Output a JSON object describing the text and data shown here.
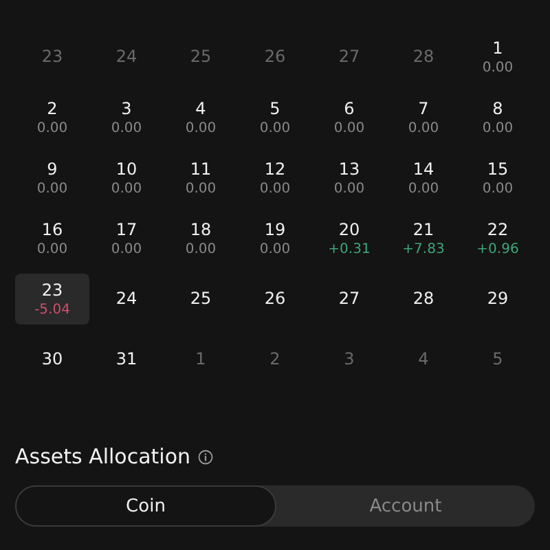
{
  "calendar": {
    "weeks": [
      [
        {
          "day": "23",
          "other_month": true,
          "selected": false
        },
        {
          "day": "24",
          "other_month": true,
          "selected": false
        },
        {
          "day": "25",
          "other_month": true,
          "selected": false
        },
        {
          "day": "26",
          "other_month": true,
          "selected": false
        },
        {
          "day": "27",
          "other_month": true,
          "selected": false
        },
        {
          "day": "28",
          "other_month": true,
          "selected": false
        },
        {
          "day": "1",
          "other_month": false,
          "selected": false,
          "value": "0.00",
          "color": "#8a8a8a"
        }
      ],
      [
        {
          "day": "2",
          "other_month": false,
          "selected": false,
          "value": "0.00",
          "color": "#8a8a8a"
        },
        {
          "day": "3",
          "other_month": false,
          "selected": false,
          "value": "0.00",
          "color": "#8a8a8a"
        },
        {
          "day": "4",
          "other_month": false,
          "selected": false,
          "value": "0.00",
          "color": "#8a8a8a"
        },
        {
          "day": "5",
          "other_month": false,
          "selected": false,
          "value": "0.00",
          "color": "#8a8a8a"
        },
        {
          "day": "6",
          "other_month": false,
          "selected": false,
          "value": "0.00",
          "color": "#8a8a8a"
        },
        {
          "day": "7",
          "other_month": false,
          "selected": false,
          "value": "0.00",
          "color": "#8a8a8a"
        },
        {
          "day": "8",
          "other_month": false,
          "selected": false,
          "value": "0.00",
          "color": "#8a8a8a"
        }
      ],
      [
        {
          "day": "9",
          "other_month": false,
          "selected": false,
          "value": "0.00",
          "color": "#8a8a8a"
        },
        {
          "day": "10",
          "other_month": false,
          "selected": false,
          "value": "0.00",
          "color": "#8a8a8a"
        },
        {
          "day": "11",
          "other_month": false,
          "selected": false,
          "value": "0.00",
          "color": "#8a8a8a"
        },
        {
          "day": "12",
          "other_month": false,
          "selected": false,
          "value": "0.00",
          "color": "#8a8a8a"
        },
        {
          "day": "13",
          "other_month": false,
          "selected": false,
          "value": "0.00",
          "color": "#8a8a8a"
        },
        {
          "day": "14",
          "other_month": false,
          "selected": false,
          "value": "0.00",
          "color": "#8a8a8a"
        },
        {
          "day": "15",
          "other_month": false,
          "selected": false,
          "value": "0.00",
          "color": "#8a8a8a"
        }
      ],
      [
        {
          "day": "16",
          "other_month": false,
          "selected": false,
          "value": "0.00",
          "color": "#8a8a8a"
        },
        {
          "day": "17",
          "other_month": false,
          "selected": false,
          "value": "0.00",
          "color": "#8a8a8a"
        },
        {
          "day": "18",
          "other_month": false,
          "selected": false,
          "value": "0.00",
          "color": "#8a8a8a"
        },
        {
          "day": "19",
          "other_month": false,
          "selected": false,
          "value": "0.00",
          "color": "#8a8a8a"
        },
        {
          "day": "20",
          "other_month": false,
          "selected": false,
          "value": "+0.31",
          "color": "#3fa77a"
        },
        {
          "day": "21",
          "other_month": false,
          "selected": false,
          "value": "+7.83",
          "color": "#3fa77a"
        },
        {
          "day": "22",
          "other_month": false,
          "selected": false,
          "value": "+0.96",
          "color": "#3fa77a"
        }
      ],
      [
        {
          "day": "23",
          "other_month": false,
          "selected": true,
          "value": "-5.04",
          "color": "#d0506e"
        },
        {
          "day": "24",
          "other_month": false,
          "selected": false
        },
        {
          "day": "25",
          "other_month": false,
          "selected": false
        },
        {
          "day": "26",
          "other_month": false,
          "selected": false
        },
        {
          "day": "27",
          "other_month": false,
          "selected": false
        },
        {
          "day": "28",
          "other_month": false,
          "selected": false
        },
        {
          "day": "29",
          "other_month": false,
          "selected": false
        }
      ],
      [
        {
          "day": "30",
          "other_month": false,
          "selected": false
        },
        {
          "day": "31",
          "other_month": false,
          "selected": false
        },
        {
          "day": "1",
          "other_month": true,
          "selected": false
        },
        {
          "day": "2",
          "other_month": true,
          "selected": false
        },
        {
          "day": "3",
          "other_month": true,
          "selected": false
        },
        {
          "day": "4",
          "other_month": true,
          "selected": false
        },
        {
          "day": "5",
          "other_month": true,
          "selected": false
        }
      ]
    ]
  },
  "assets_allocation": {
    "title": "Assets Allocation",
    "tabs": [
      {
        "label": "Coin",
        "selected": true
      },
      {
        "label": "Account",
        "selected": false
      }
    ]
  }
}
